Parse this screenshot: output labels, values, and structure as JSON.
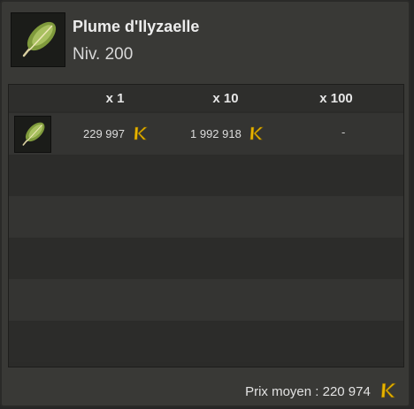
{
  "item": {
    "name": "Plume d'Ilyzaelle",
    "level": "Niv. 200",
    "icon": "feather-icon"
  },
  "table": {
    "headers": [
      "x 1",
      "x 10",
      "x 100"
    ],
    "rows": [
      {
        "icon": "feather-icon",
        "x1": "229 997",
        "x10": "1 992 918",
        "x100": "-"
      }
    ]
  },
  "currency": {
    "icon": "kama-icon",
    "color": "#e8b400"
  },
  "average": {
    "label": "Prix moyen : 220 974"
  }
}
